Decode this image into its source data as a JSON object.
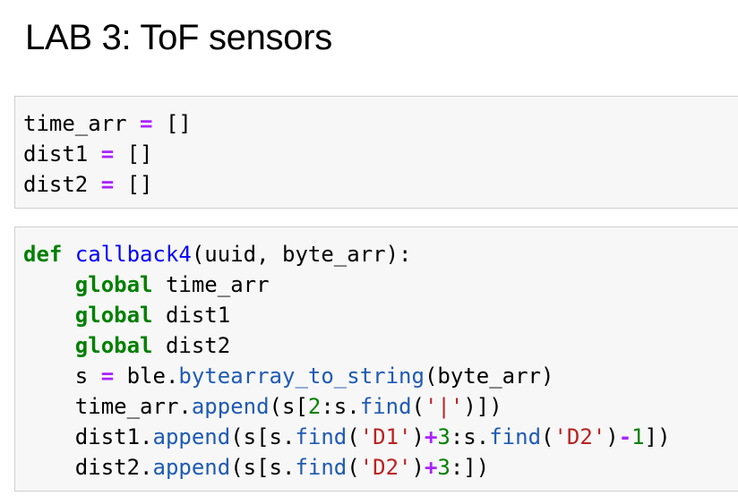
{
  "heading": "LAB 3: ToF sensors",
  "cell1": {
    "line1": {
      "a": "time_arr ",
      "op": "=",
      "b": " []"
    },
    "line2": {
      "a": "dist1 ",
      "op": "=",
      "b": " []"
    },
    "line3": {
      "a": "dist2 ",
      "op": "=",
      "b": " []"
    }
  },
  "cell2": {
    "line1": {
      "kw": "def",
      "sp": " ",
      "fn": "callback4",
      "rest": "(uuid, byte_arr):"
    },
    "line2": {
      "indent": "    ",
      "kw": "global",
      "rest": " time_arr"
    },
    "line3": {
      "indent": "    ",
      "kw": "global",
      "rest": " dist1"
    },
    "line4": {
      "indent": "    ",
      "kw": "global",
      "rest": " dist2"
    },
    "line5": {
      "a": "    s ",
      "op": "=",
      "b": " ble.",
      "attr": "bytearray_to_string",
      "c": "(byte_arr)"
    },
    "line6": {
      "a": "    time_arr.",
      "attr1": "append",
      "b": "(s[",
      "n1": "2",
      "c": ":s.",
      "attr2": "find",
      "d": "(",
      "s1": "'|'",
      "e": ")])"
    },
    "line7": {
      "a": "    dist1.",
      "attr1": "append",
      "b": "(s[s.",
      "attr2": "find",
      "c": "(",
      "s1": "'D1'",
      "d": ")",
      "op1": "+",
      "n1": "3",
      "e": ":s.",
      "attr3": "find",
      "f": "(",
      "s2": "'D2'",
      "g": ")",
      "op2": "-",
      "n2": "1",
      "h": "])"
    },
    "line8": {
      "a": "    dist2.",
      "attr1": "append",
      "b": "(s[s.",
      "attr2": "find",
      "c": "(",
      "s1": "'D2'",
      "d": ")",
      "op1": "+",
      "n1": "3",
      "e": ":])"
    }
  }
}
